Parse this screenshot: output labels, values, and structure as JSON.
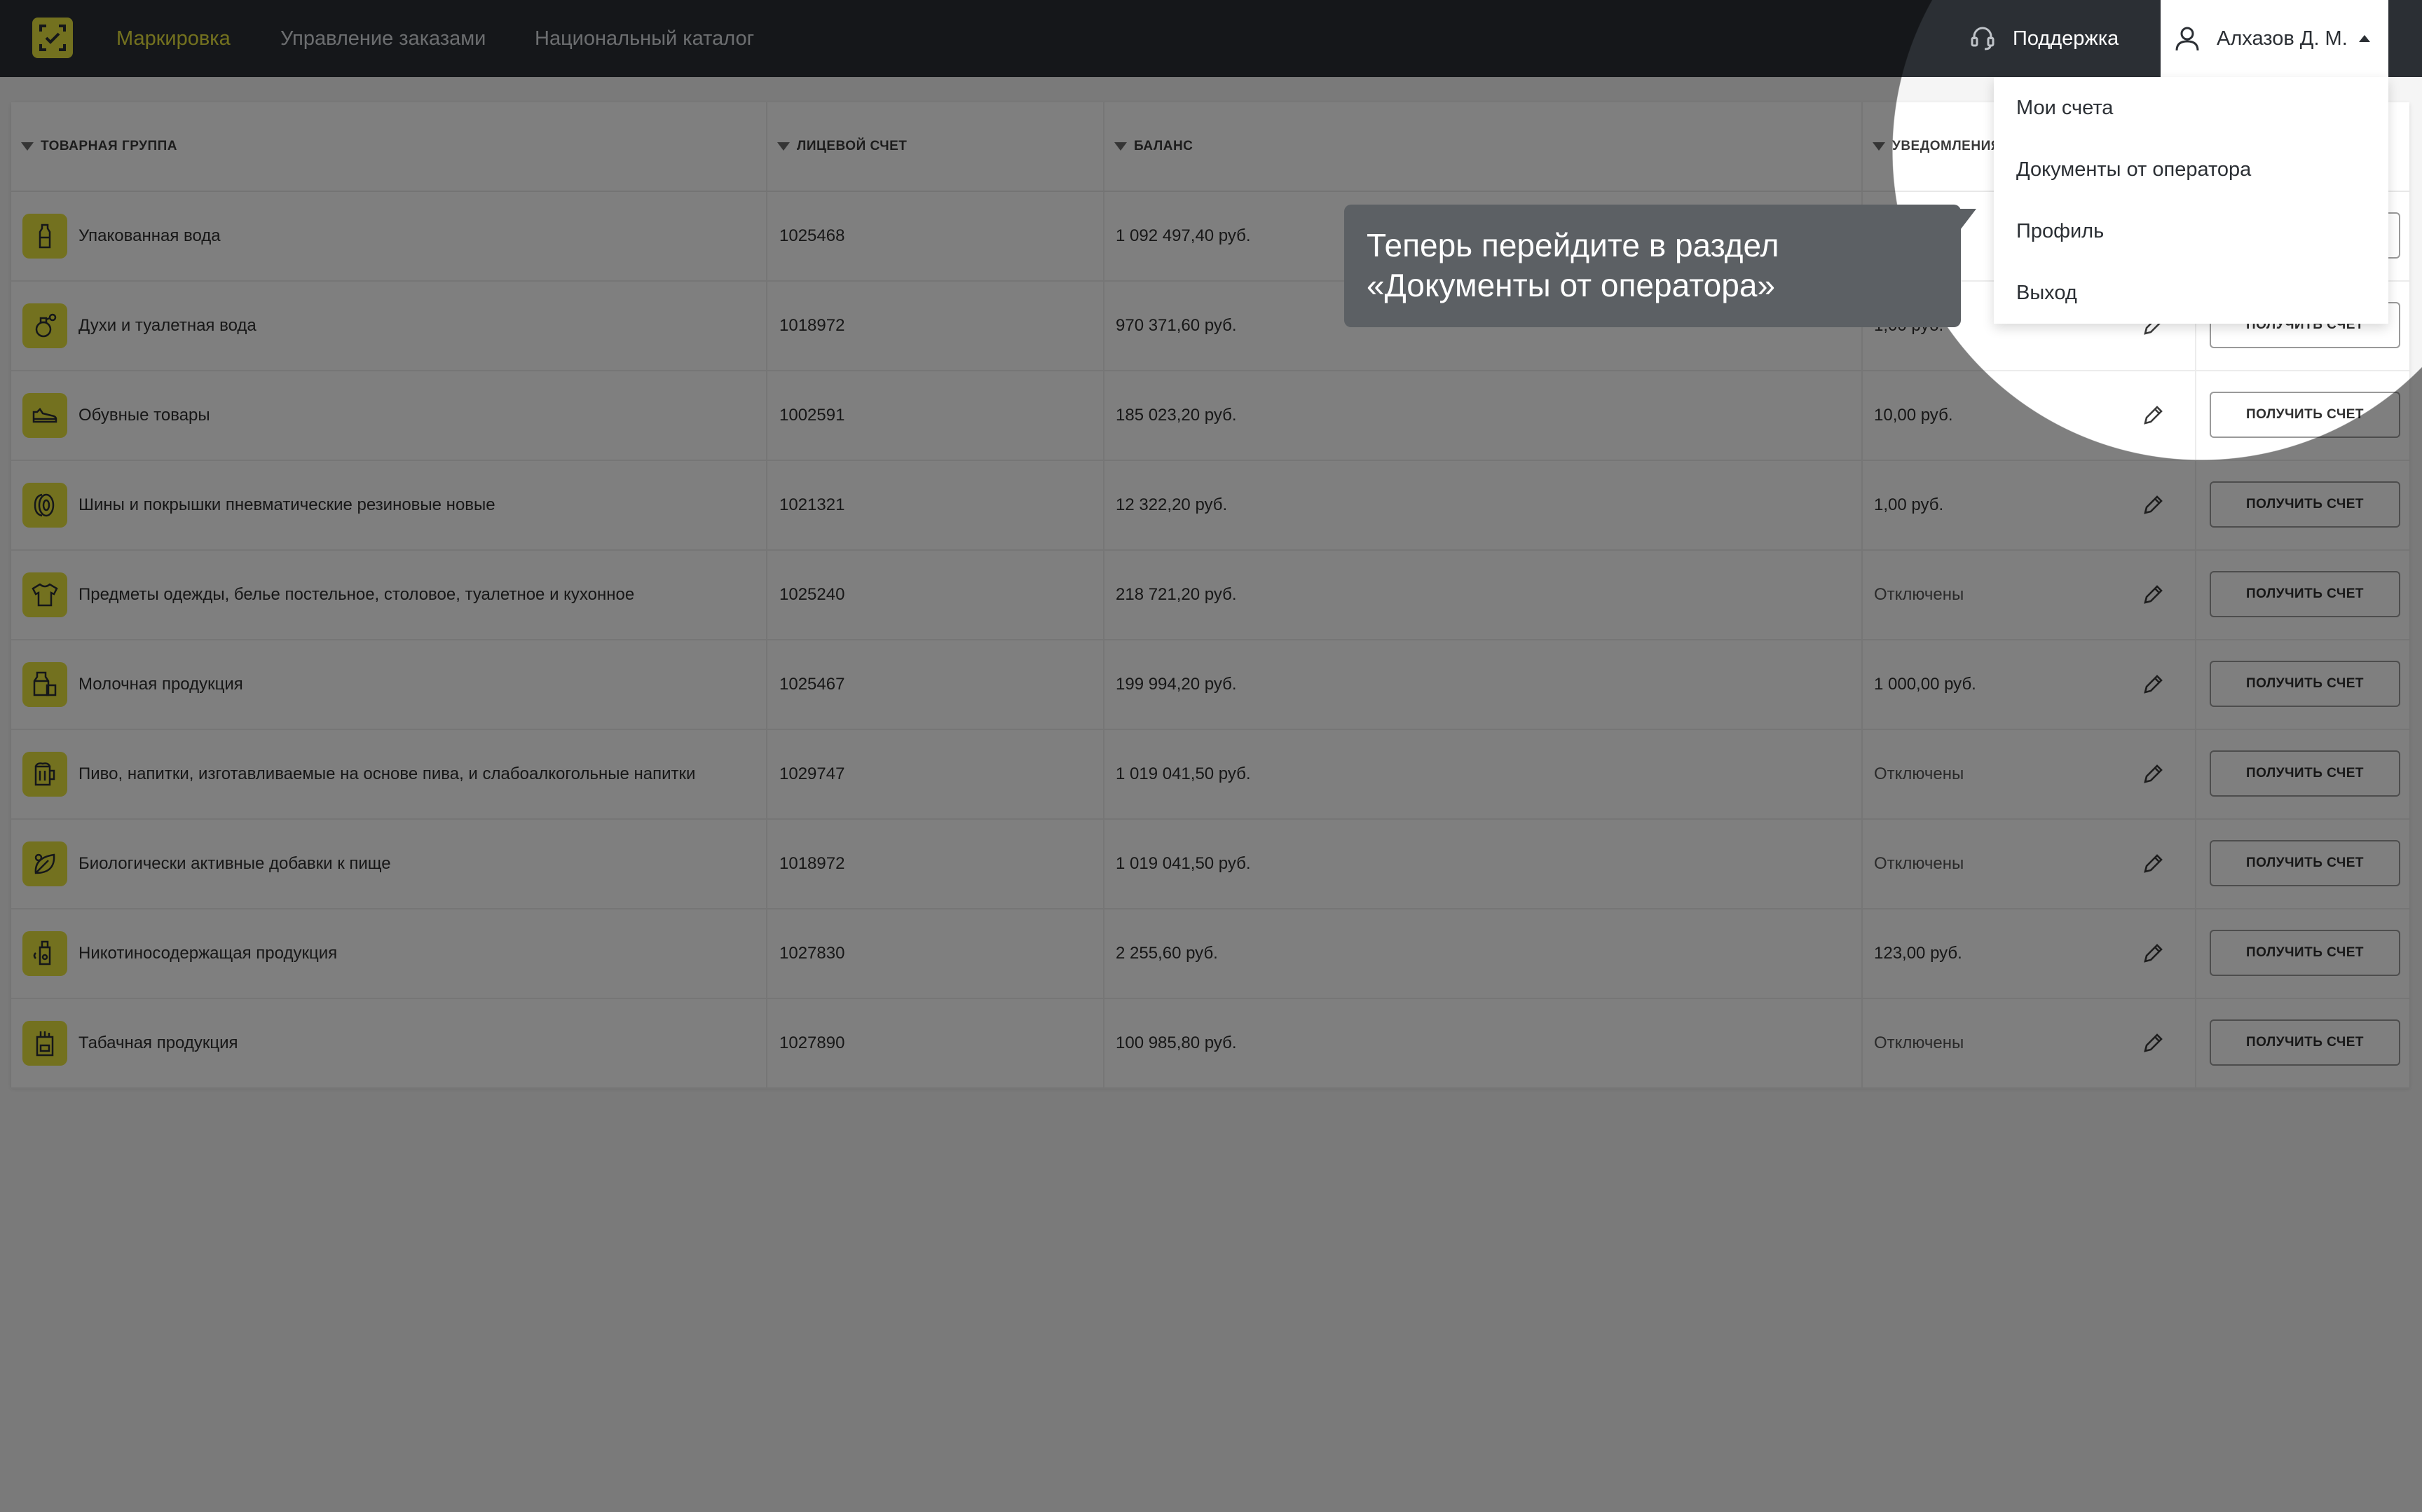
{
  "nav": {
    "items": [
      "Маркировка",
      "Управление заказами",
      "Национальный каталог"
    ],
    "support": "Поддержка",
    "user": "Алхазов Д. М."
  },
  "table": {
    "headers": [
      "ТОВАРНАЯ ГРУППА",
      "ЛИЦЕВОЙ СЧЕТ",
      "БАЛАНС",
      "УВЕДОМЛЕНИЯ"
    ],
    "button_label": "ПОЛУЧИТЬ СЧЕТ",
    "rows": [
      {
        "group": "Упакованная вода",
        "account": "1025468",
        "balance": "1 092 497,40 руб.",
        "notify": "",
        "icon": "water-bottle-icon"
      },
      {
        "group": "Духи и туалетная вода",
        "account": "1018972",
        "balance": "970 371,60 руб.",
        "notify": "1,00 руб.",
        "icon": "perfume-icon"
      },
      {
        "group": "Обувные товары",
        "account": "1002591",
        "balance": "185 023,20 руб.",
        "notify": "10,00 руб.",
        "icon": "shoe-icon"
      },
      {
        "group": "Шины и покрышки пневматические резиновые новые",
        "account": "1021321",
        "balance": "12 322,20 руб.",
        "notify": "1,00 руб.",
        "icon": "tire-icon"
      },
      {
        "group": "Предметы одежды, белье постельное, столовое, туалетное и кухонное",
        "account": "1025240",
        "balance": "218 721,20 руб.",
        "notify": "Отключены",
        "icon": "tshirt-icon"
      },
      {
        "group": "Молочная продукция",
        "account": "1025467",
        "balance": "199 994,20 руб.",
        "notify": "1 000,00 руб.",
        "icon": "milk-icon"
      },
      {
        "group": "Пиво, напитки, изготавливаемые на основе пива, и слабоалкогольные напитки",
        "account": "1029747",
        "balance": "1 019 041,50 руб.",
        "notify": "Отключены",
        "icon": "beer-icon"
      },
      {
        "group": "Биологически активные добавки к пище",
        "account": "1018972",
        "balance": "1 019 041,50 руб.",
        "notify": "Отключены",
        "icon": "leaf-icon"
      },
      {
        "group": "Никотиносодержащая продукция",
        "account": "1027830",
        "balance": "2 255,60 руб.",
        "notify": "123,00 руб.",
        "icon": "vape-icon"
      },
      {
        "group": "Табачная продукция",
        "account": "1027890",
        "balance": "100 985,80 руб.",
        "notify": "Отключены",
        "icon": "cigarette-pack-icon"
      }
    ]
  },
  "dropdown": {
    "items": [
      "Мои счета",
      "Документы от оператора",
      "Профиль",
      "Выход"
    ]
  },
  "tooltip": {
    "line1": "Теперь перейдите в раздел",
    "line2": "«Документы от оператора»"
  },
  "colors": {
    "accent": "#e6e33e",
    "topbar": "#2b2f34",
    "tooltip": "#5c6064"
  }
}
